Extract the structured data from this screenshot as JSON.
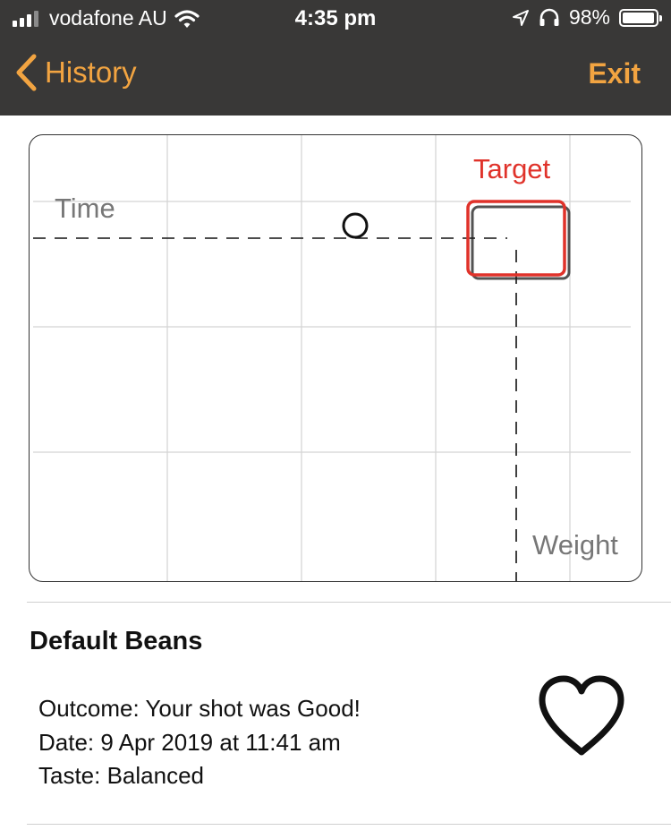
{
  "status_bar": {
    "carrier": "vodafone AU",
    "time": "4:35 pm",
    "battery": "98%",
    "battery_level": 0.98,
    "icons": [
      "signal-icon",
      "wifi-icon",
      "location-arrow-icon",
      "headphones-icon",
      "battery-icon"
    ]
  },
  "nav": {
    "back_label": "History",
    "exit_label": "Exit"
  },
  "chart": {
    "y_label": "Time",
    "x_label": "Weight",
    "target_label": "Target",
    "accent_color": "#e0322a",
    "shot_marker": "circle",
    "target_marker": "square"
  },
  "entry": {
    "title": "Default Beans",
    "outcome": "Outcome: Your shot was Good!",
    "date": "Date: 9 Apr 2019 at 11:41 am",
    "taste": "Taste: Balanced",
    "favorite_icon": "heart-outline-icon"
  },
  "colors": {
    "nav_background": "#393837",
    "nav_accent": "#f2a441"
  }
}
